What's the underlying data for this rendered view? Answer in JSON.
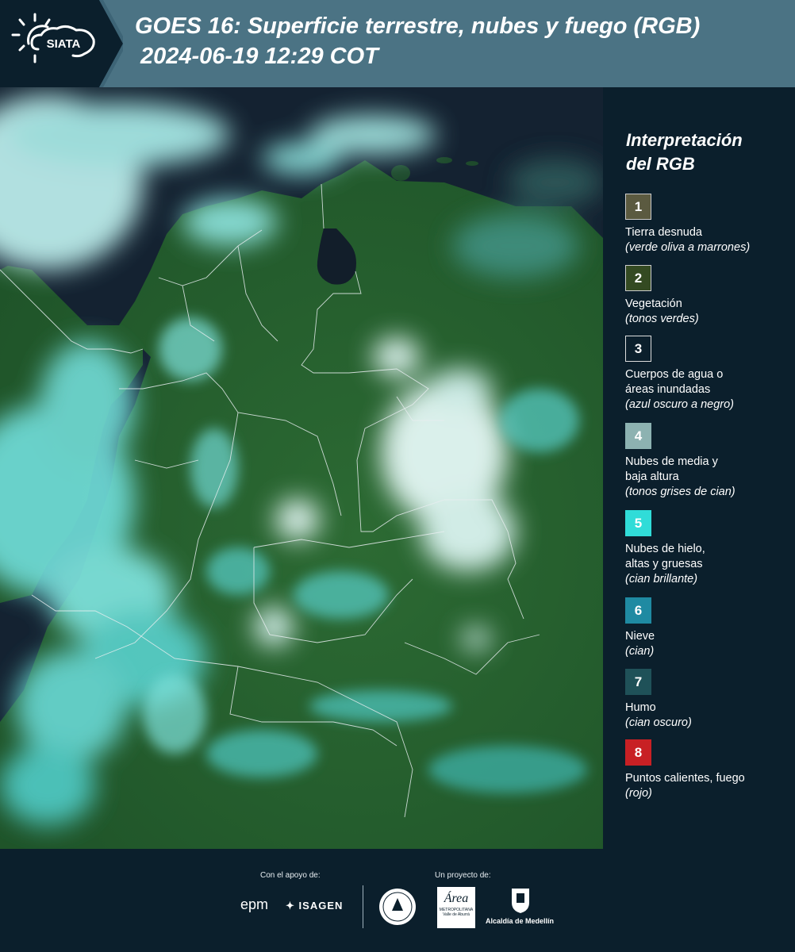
{
  "header": {
    "logo_text": "SIATA",
    "title_line1": "GOES 16: Superficie terrestre, nubes y fuego (RGB)",
    "title_line2": "2024-06-19 12:29 COT"
  },
  "legend": {
    "title_line1": "Interpretación",
    "title_line2": "del RGB",
    "items": [
      {
        "number": "1",
        "color": "#5b5a40",
        "label_lines": [
          "Tierra desnuda"
        ],
        "sub": "(verde oliva a marrones)"
      },
      {
        "number": "2",
        "color": "#344a22",
        "label_lines": [
          "Vegetación"
        ],
        "sub": "(tonos verdes)"
      },
      {
        "number": "3",
        "color": "#0b1f2c",
        "label_lines": [
          "Cuerpos de agua o",
          "áreas inundadas"
        ],
        "sub": "(azul oscuro a negro)"
      },
      {
        "number": "4",
        "color": "#8db2b1",
        "label_lines": [
          "Nubes de media y",
          "baja altura"
        ],
        "sub": "(tonos grises de cian)"
      },
      {
        "number": "5",
        "color": "#30dcd8",
        "label_lines": [
          "Nubes de hielo,",
          "altas y gruesas"
        ],
        "sub": "(cian brillante)"
      },
      {
        "number": "6",
        "color": "#1f8aa2",
        "label_lines": [
          "Nieve"
        ],
        "sub": "(cian)"
      },
      {
        "number": "7",
        "color": "#1f5158",
        "label_lines": [
          "Humo"
        ],
        "sub": "(cian oscuro)"
      },
      {
        "number": "8",
        "color": "#c82024",
        "label_lines": [
          "Puntos calientes, fuego"
        ],
        "sub": "(rojo)"
      }
    ]
  },
  "footer": {
    "support_label": "Con el apoyo de:",
    "project_label": "Un proyecto de:",
    "sponsors": [
      "epm",
      "ISAGEN"
    ],
    "partners": [
      "Área",
      "METROPOLITANA",
      "Valle de Aburrá",
      "Alcaldía de Medellín"
    ]
  },
  "map": {
    "colors": {
      "vegetation": "#2f6a34",
      "ocean": "#142231",
      "cloud_bright": "#d9f7f5",
      "cloud_cyan": "#4fe0dc",
      "borders": "#e8eef0"
    }
  }
}
